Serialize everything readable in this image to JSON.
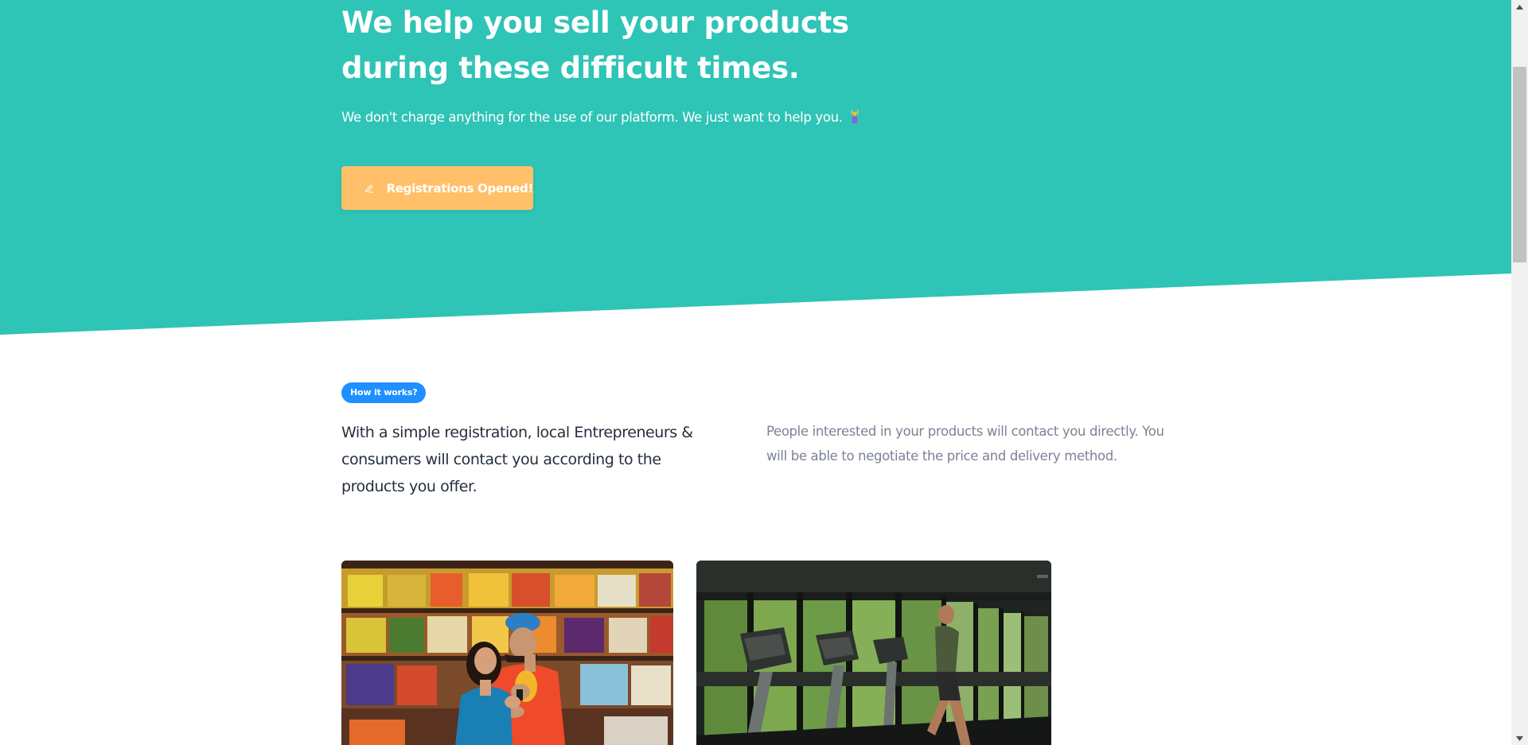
{
  "hero": {
    "title_line1": "We help you sell your products",
    "title_line2": "during these difficult times.",
    "subtitle": "We don't charge anything for the use of our platform. We just want to help you.",
    "button_label": "Registrations Opened!",
    "button_icon": "pencil-icon",
    "emoji_icon": "person-raising-hands-icon"
  },
  "how_it_works": {
    "badge": "How it works?",
    "lead": "With a simple registration, local Entrepreneurs & consumers will contact you according to the products you offer.",
    "description": "People interested in your products will contact you directly. You will be able to negotiate the price and delivery method."
  },
  "cards": [
    {
      "image": "grocery-store-photo"
    },
    {
      "image": "gym-treadmill-photo"
    }
  ],
  "colors": {
    "hero_bg": "#2ec4b6",
    "button_bg": "#ffc069",
    "badge_bg": "#1e90ff",
    "lead_text": "#252f3d",
    "muted_text": "#7b8294"
  }
}
